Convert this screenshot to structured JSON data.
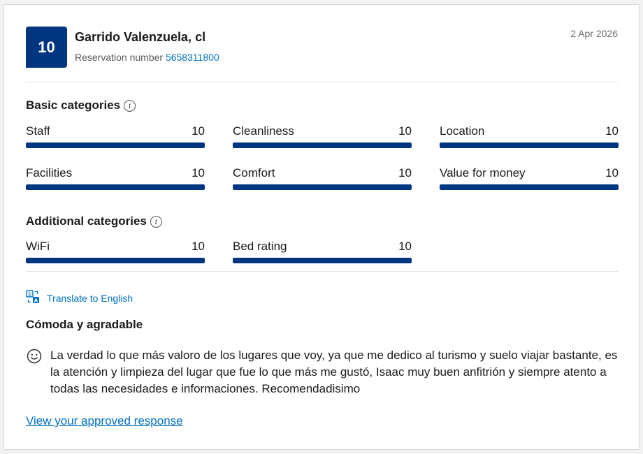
{
  "header": {
    "score": "10",
    "guest_name": "Garrido Valenzuela, cl",
    "reservation_label": "Reservation number",
    "reservation_number": "5658311800",
    "date": "2 Apr 2026"
  },
  "basic": {
    "title": "Basic categories",
    "info_icon": "info-icon",
    "items": [
      {
        "label": "Staff",
        "score": "10",
        "fill_fraction": 1.0
      },
      {
        "label": "Cleanliness",
        "score": "10",
        "fill_fraction": 1.0
      },
      {
        "label": "Location",
        "score": "10",
        "fill_fraction": 1.0
      },
      {
        "label": "Facilities",
        "score": "10",
        "fill_fraction": 1.0
      },
      {
        "label": "Comfort",
        "score": "10",
        "fill_fraction": 1.0
      },
      {
        "label": "Value for money",
        "score": "10",
        "fill_fraction": 1.0
      }
    ]
  },
  "additional": {
    "title": "Additional categories",
    "info_icon": "info-icon",
    "items": [
      {
        "label": "WiFi",
        "score": "10",
        "fill_fraction": 1.0
      },
      {
        "label": "Bed rating",
        "score": "10",
        "fill_fraction": 1.0
      }
    ]
  },
  "translate": {
    "icon": "translate-icon",
    "label": "Translate to English"
  },
  "review": {
    "title": "Cómoda y agradable",
    "sentiment_icon": "smiley-icon",
    "text": "La verdad lo que más valoro de los lugares que voy, ya que me dedico al turismo y suelo viajar bastante, es la atención y limpieza del lugar que fue lo que más me gustó, Isaac muy buen anfitrión y siempre atento a todas las necesidades e informaciones. Recomendadisimo"
  },
  "response_link": "View your approved response",
  "colors": {
    "brand": "#003580",
    "link": "#0071c2"
  }
}
